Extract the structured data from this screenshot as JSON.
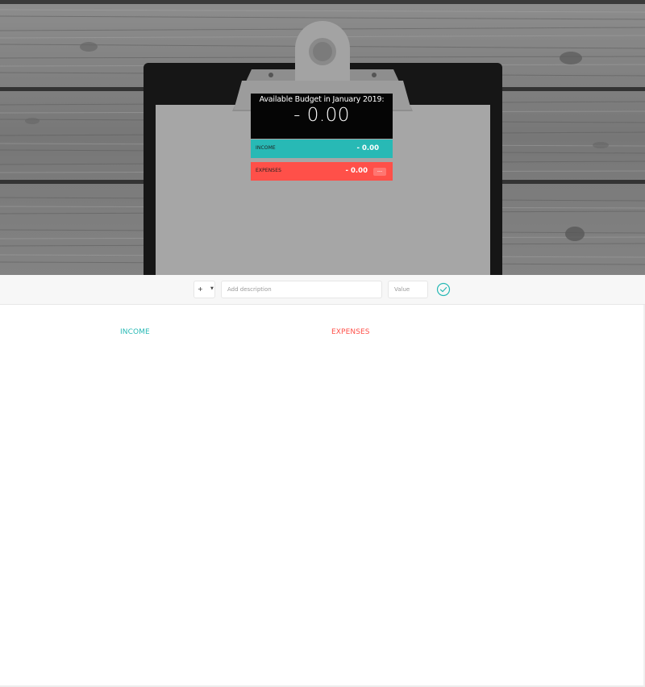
{
  "budget": {
    "title": "Available Budget in January 2019:",
    "value": "- 0.00",
    "income_label": "INCOME",
    "income_value": "- 0.00",
    "expenses_label": "EXPENSES",
    "expenses_value": "- 0.00",
    "expenses_percentage": "---"
  },
  "add_form": {
    "type_value": "+",
    "description_placeholder": "Add description",
    "value_placeholder": "Value"
  },
  "columns": {
    "income_title": "INCOME",
    "expenses_title": "EXPENSES"
  },
  "colors": {
    "income": "#28b9b5",
    "expenses": "#ff5049",
    "budget_panel": "#050505"
  },
  "icons": {
    "add_button": "check-circle-icon",
    "type_caret": "caret-down-icon"
  }
}
